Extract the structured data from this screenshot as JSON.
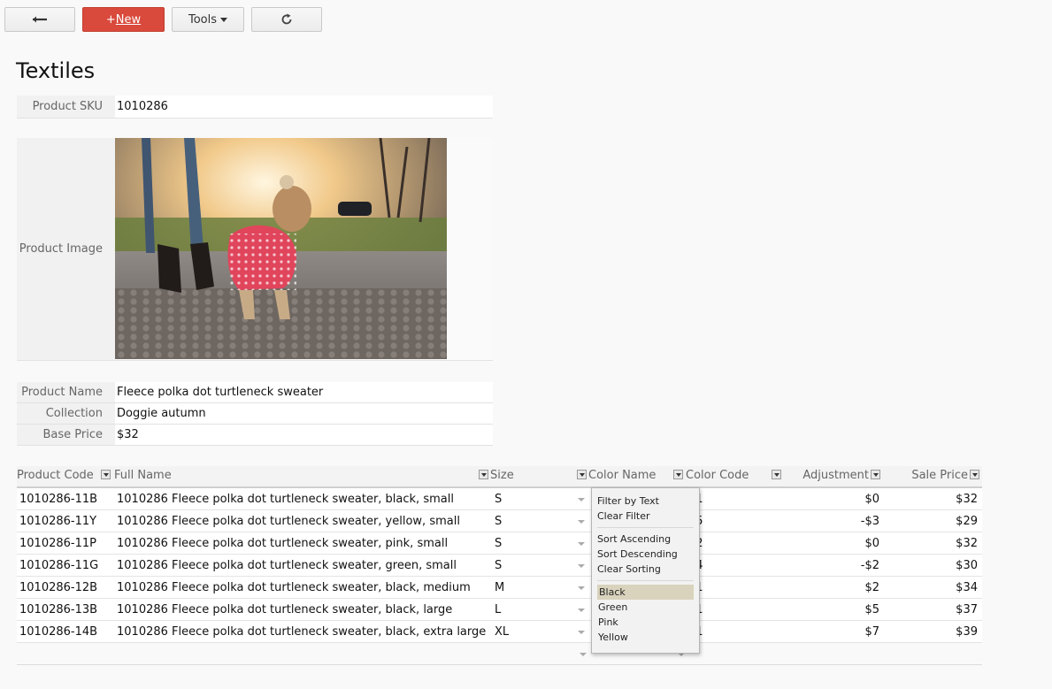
{
  "toolbar": {
    "back_icon": "arrow-left-icon",
    "new_prefix": "+",
    "new_label": "New",
    "tools_label": "Tools",
    "reload_icon": "reload-icon",
    "new_color": "#d9493c"
  },
  "page": {
    "title": "Textiles"
  },
  "record": {
    "sku_label": "Product SKU",
    "sku_value": "1010286",
    "image_label": "Product Image",
    "name_label": "Product Name",
    "name_value": "Fleece polka dot turtleneck sweater",
    "collection_label": "Collection",
    "collection_value": "Doggie autumn",
    "price_label": "Base Price",
    "price_value": "$32"
  },
  "table": {
    "headers": [
      "Product Code",
      "Full Name",
      "Size",
      "Color Name",
      "Color Code",
      "Adjustment",
      "Sale Price"
    ],
    "rows": [
      [
        "1010286-11B",
        "1010286 Fleece polka dot turtleneck sweater, black, small",
        "S",
        "",
        "01",
        "$0",
        "$32"
      ],
      [
        "1010286-11Y",
        "1010286 Fleece polka dot turtleneck sweater, yellow, small",
        "S",
        "",
        "15",
        "-$3",
        "$29"
      ],
      [
        "1010286-11P",
        "1010286 Fleece polka dot turtleneck sweater, pink, small",
        "S",
        "",
        "32",
        "$0",
        "$32"
      ],
      [
        "1010286-11G",
        "1010286 Fleece polka dot turtleneck sweater, green, small",
        "S",
        "",
        "04",
        "-$2",
        "$30"
      ],
      [
        "1010286-12B",
        "1010286 Fleece polka dot turtleneck sweater, black, medium",
        "M",
        "",
        "01",
        "$2",
        "$34"
      ],
      [
        "1010286-13B",
        "1010286 Fleece polka dot turtleneck sweater, black, large",
        "L",
        "",
        "01",
        "$5",
        "$37"
      ],
      [
        "1010286-14B",
        "1010286 Fleece polka dot turtleneck sweater, black, extra large",
        "XL",
        "",
        "01",
        "$7",
        "$39"
      ]
    ]
  },
  "filter_menu": {
    "filter_by_text": "Filter by Text",
    "clear_filter": "Clear Filter",
    "sort_ascending": "Sort Ascending",
    "sort_descending": "Sort Descending",
    "clear_sorting": "Clear Sorting",
    "options": [
      "Black",
      "Green",
      "Pink",
      "Yellow"
    ],
    "selected_option": "Black",
    "highlight_color": "#d9d3bd"
  }
}
